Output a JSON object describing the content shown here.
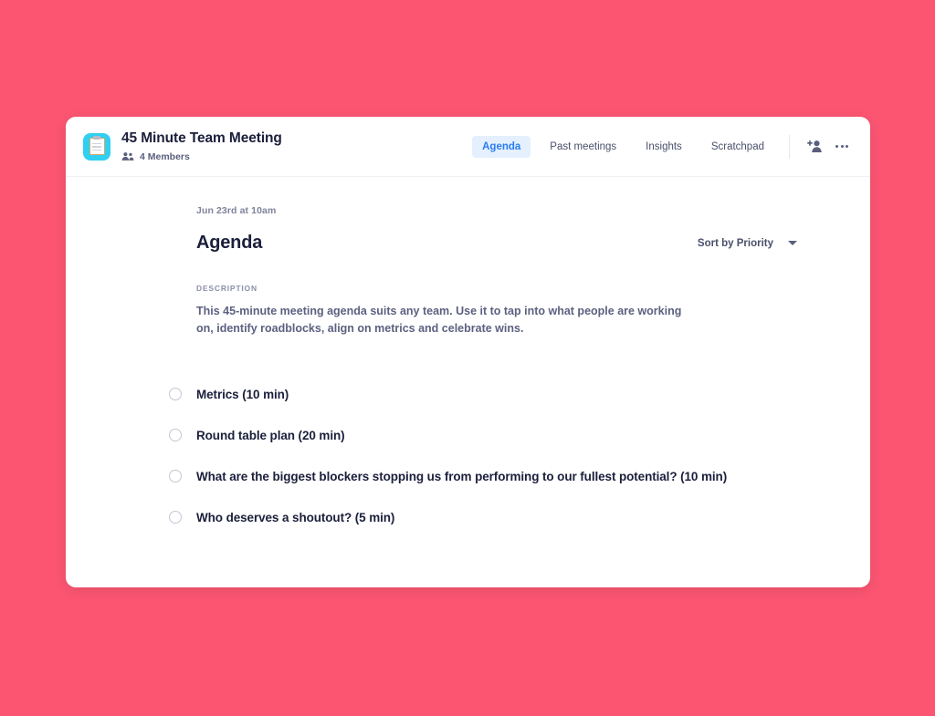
{
  "theme": {
    "page_background": "#fb5572",
    "card_background": "#ffffff",
    "accent_blue": "#2a7cf0",
    "accent_blue_bg": "#e4f0fe",
    "app_icon_color": "#30d0f2",
    "heading_color": "#1b1f3b",
    "muted_text": "#5c6180"
  },
  "header": {
    "app_icon": "clipboard-icon",
    "title": "45 Minute Team Meeting",
    "members_icon": "people-icon",
    "members_label": "4 Members",
    "tabs": [
      {
        "label": "Agenda",
        "active": true
      },
      {
        "label": "Past meetings",
        "active": false
      },
      {
        "label": "Insights",
        "active": false
      },
      {
        "label": "Scratchpad",
        "active": false
      }
    ],
    "actions": [
      {
        "name": "add-person-icon",
        "label": "Add person"
      },
      {
        "name": "more-options-icon",
        "label": "More options"
      }
    ]
  },
  "main": {
    "date": "Jun 23rd at 10am",
    "heading": "Agenda",
    "sort": {
      "label": "Sort by Priority",
      "caret_icon": "chevron-down-icon"
    },
    "description_label": "DESCRIPTION",
    "description_text": "This 45-minute meeting agenda suits any team. Use it to tap into what people are working on, identify roadblocks, align on metrics and celebrate wins.",
    "items": [
      {
        "label": "Metrics (10 min)",
        "checked": false
      },
      {
        "label": "Round table plan (20 min)",
        "checked": false
      },
      {
        "label": "What are the biggest blockers stopping us from performing to our fullest potential? (10 min)",
        "checked": false
      },
      {
        "label": "Who deserves a shoutout? (5 min)",
        "checked": false
      }
    ]
  }
}
